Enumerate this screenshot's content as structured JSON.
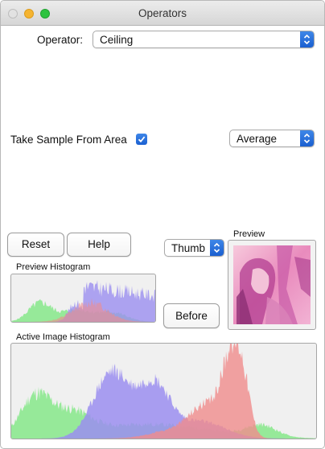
{
  "window": {
    "title": "Operators"
  },
  "operator": {
    "label": "Operator:",
    "value": "Ceiling"
  },
  "sample": {
    "label": "Take Sample From Area",
    "checked": true,
    "mode": "Average"
  },
  "buttons": {
    "reset": "Reset",
    "help": "Help",
    "before": "Before"
  },
  "view_select": {
    "value": "Thumb"
  },
  "preview": {
    "label": "Preview"
  },
  "preview_histogram": {
    "label": "Preview Histogram"
  },
  "active_histogram": {
    "label": "Active Image Histogram"
  },
  "colors": {
    "accent": "#1f66d6",
    "hist_red": "#f08c8c",
    "hist_green": "#86e88a",
    "hist_blue": "#9b8ef0"
  }
}
